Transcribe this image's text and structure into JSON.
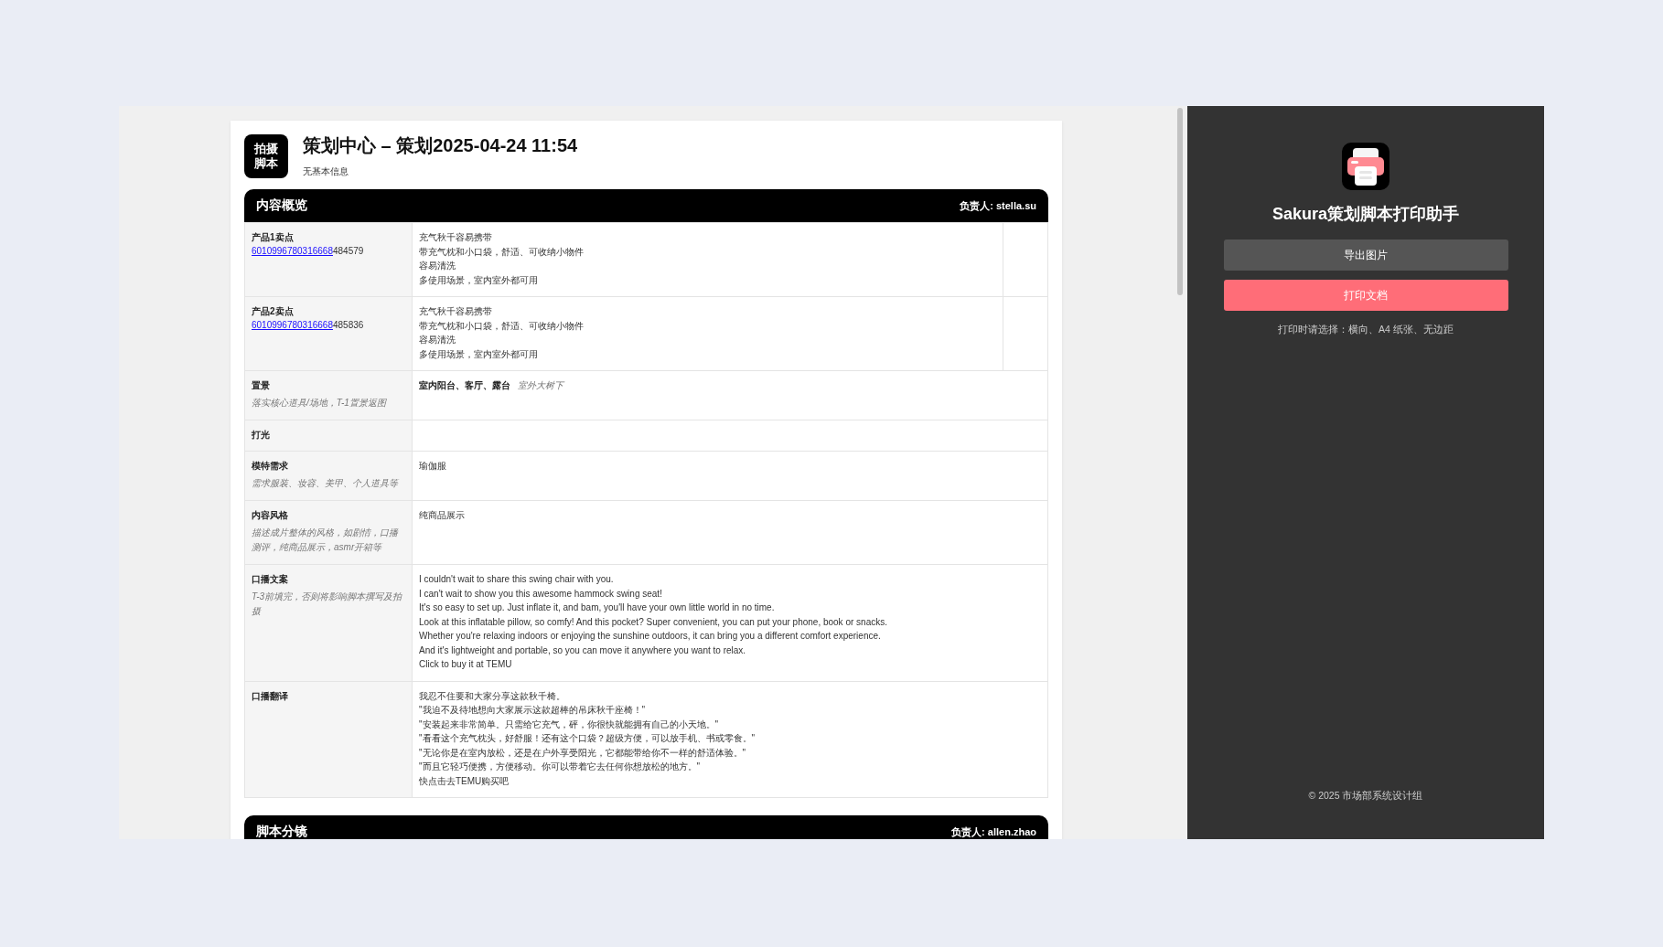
{
  "document": {
    "badge": [
      "拍摄",
      "脚本"
    ],
    "title": "策划中心 – 策划2025-04-24 11:54",
    "subtitle": "无基本信息"
  },
  "overview": {
    "title": "内容概览",
    "owner": "负责人: stella.su",
    "rows": [
      {
        "kind": "product",
        "label": "产品1卖点",
        "link": "6010996780316668",
        "link_suffix": "484579",
        "lines": [
          "充气秋千容易携带",
          "带充气枕和小口袋，舒适、可收纳小物件",
          "容易清洗",
          "多使用场景，室内室外都可用"
        ]
      },
      {
        "kind": "product",
        "label": "产品2卖点",
        "link": "6010996780316668",
        "link_suffix": "485836",
        "lines": [
          "充气秋千容易携带",
          "带充气枕和小口袋，舒适、可收纳小物件",
          "容易清洗",
          "多使用场景，室内室外都可用"
        ]
      },
      {
        "kind": "tags",
        "label": "置景",
        "hint": "落实核心道具/场地，T-1置景返图",
        "primary": "室内阳台、客厅、露台",
        "secondary": "室外大树下"
      },
      {
        "kind": "text",
        "label": "打光"
      },
      {
        "kind": "text",
        "label": "模特需求",
        "hint": "需求服装、妆容、美甲、个人道具等",
        "lines": [
          "瑜伽服"
        ]
      },
      {
        "kind": "text",
        "label": "内容风格",
        "hint": "描述成片整体的风格，如剧情，口播测评，纯商品展示，asmr开箱等",
        "lines": [
          "纯商品展示"
        ]
      },
      {
        "kind": "text",
        "label": "口播文案",
        "hint": "T-3前填完，否则将影响脚本撰写及拍摄",
        "lines": [
          "I couldn't wait to share this swing chair with you.",
          "I can't wait to show you this awesome hammock swing seat!",
          "It's so easy to set up. Just inflate it, and bam, you'll have your own little world in no time.",
          "Look at this inflatable pillow, so comfy! And this pocket? Super convenient, you can put your phone, book or snacks.",
          "Whether you're relaxing indoors or enjoying the sunshine outdoors, it can bring you a different comfort experience.",
          "And it's lightweight and portable, so you can move it anywhere you want to relax.",
          "Click to buy it at TEMU"
        ]
      },
      {
        "kind": "text",
        "label": "口播翻译",
        "lines": [
          "我忍不住要和大家分享这款秋千椅。",
          "\"我迫不及待地想向大家展示这款超棒的吊床秋千座椅！\"",
          "\"安装起来非常简单。只需给它充气，砰，你很快就能拥有自己的小天地。\"",
          "\"看看这个充气枕头，好舒服！还有这个口袋？超级方便，可以放手机、书或零食。\"",
          "\"无论你是在室内放松，还是在户外享受阳光，它都能带给你不一样的舒适体验。\"",
          "\"而且它轻巧便携，方便移动。你可以带着它去任何你想放松的地方。\"",
          "快点击去TEMU购买吧"
        ]
      }
    ]
  },
  "storyboard": {
    "title": "脚本分镜",
    "owner": "负责人: allen.zhao"
  },
  "sidebar": {
    "title": "Sakura策划脚本打印助手",
    "buttons": [
      {
        "label": "导出图片",
        "kind": "secondary"
      },
      {
        "label": "打印文档",
        "kind": "primary"
      }
    ],
    "note": "打印时请选择：横向、A4 纸张、无边距",
    "footer": "© 2025 市场部系统设计组"
  }
}
